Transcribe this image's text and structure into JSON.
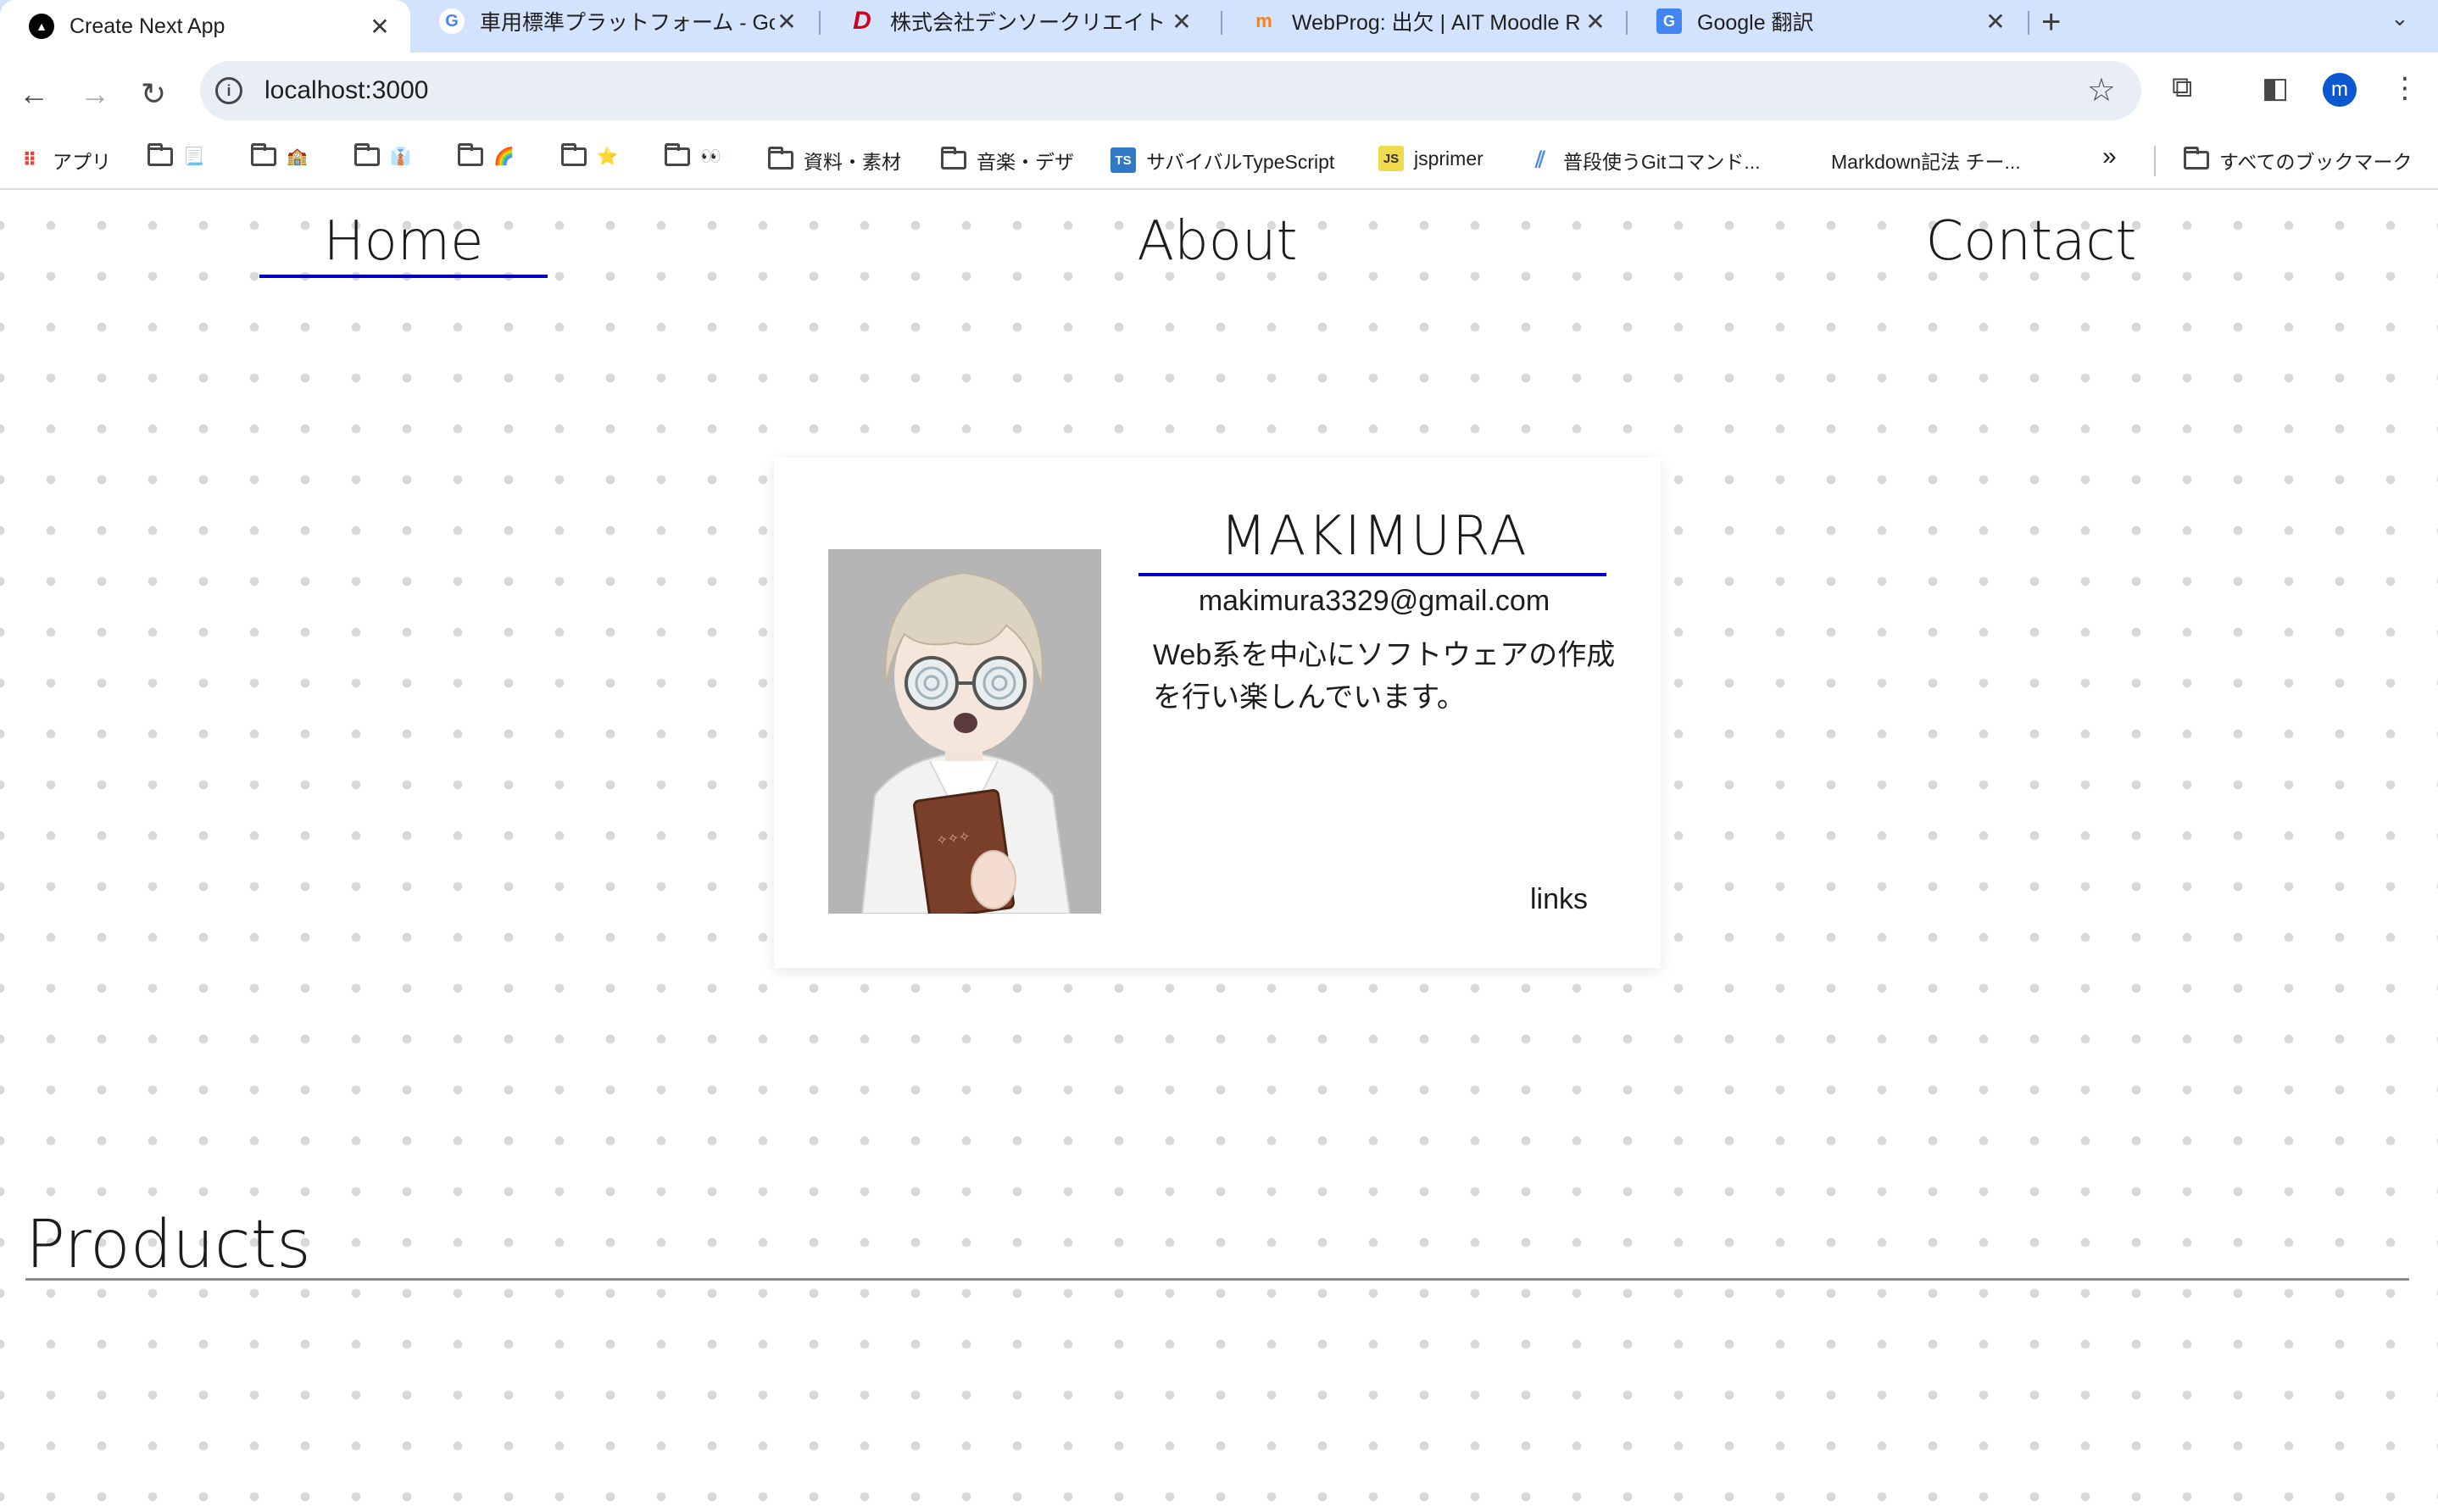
{
  "browser": {
    "tabs": [
      {
        "title": "Create Next App",
        "active": true,
        "icon": "nextjs-triangle-icon"
      },
      {
        "title": "車用標準プラットフォーム - Goo",
        "active": false,
        "icon": "google-g-icon"
      },
      {
        "title": "株式会社デンソークリエイト 公式",
        "active": false,
        "icon": "denso-d-icon"
      },
      {
        "title": "WebProg: 出欠 | AIT Moodle R",
        "active": false,
        "icon": "moodle-icon"
      },
      {
        "title": "Google 翻訳",
        "active": false,
        "icon": "google-translate-icon"
      }
    ],
    "url": "localhost:3000",
    "profile_initial": "m",
    "bookmarks": [
      {
        "label": "アプリ",
        "icon": "apps-grid-icon"
      },
      {
        "label": "",
        "emoji": "📃"
      },
      {
        "label": "",
        "emoji": "🏫"
      },
      {
        "label": "",
        "emoji": "👔"
      },
      {
        "label": "",
        "emoji": "🌈"
      },
      {
        "label": "",
        "emoji": "⭐"
      },
      {
        "label": "",
        "emoji": "👀"
      },
      {
        "label": "資料・素材"
      },
      {
        "label": "音楽・デザ"
      },
      {
        "label": "サバイバルTypeScript",
        "icon": "ts-icon"
      },
      {
        "label": "jsprimer",
        "icon": "js-icon"
      },
      {
        "label": "普段使うGitコマンド...",
        "icon": "stripe-icon"
      },
      {
        "label": "Markdown記法 チー..."
      },
      {
        "label": "すべてのブックマーク"
      }
    ]
  },
  "nav": {
    "home": "Home",
    "about": "About",
    "contact": "Contact"
  },
  "profile_card": {
    "name": "MAKIMURA",
    "email": "makimura3329@gmail.com",
    "bio": "Web系を中心にソフトウェアの作成を行い楽しんでいます。",
    "links_label": "links"
  },
  "products": {
    "title": "Products"
  },
  "colors": {
    "accent_underline": "#0000cc",
    "tab_strip": "#d3e3fd",
    "omnibox": "#e9eef6"
  }
}
